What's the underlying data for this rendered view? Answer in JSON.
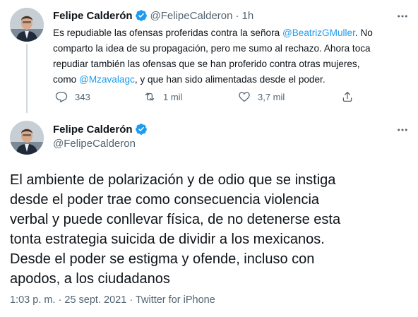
{
  "tweet1": {
    "name": "Felipe Calderón",
    "handle": "@FelipeCalderon",
    "separator": "·",
    "time": "1h",
    "body_lines": [
      [
        "Es repudiable las ofensas proferidas contra la señora ",
        "@BeatrizGMuller",
        ". No"
      ],
      [
        "comparto la idea de su propagación, pero me sumo al rechazo. Ahora toca"
      ],
      [
        "repudiar también las ofensas que se han proferido contra otras mujeres,"
      ],
      [
        "como ",
        "@Mzavalagc",
        ", y que han sido alimentadas desde el poder."
      ]
    ],
    "actions": {
      "reply_count": "343",
      "retweet_count": "1 mil",
      "like_count": "3,7 mil"
    }
  },
  "tweet2": {
    "name": "Felipe Calderón",
    "handle": "@FelipeCalderon",
    "body_lines": [
      "El ambiente de polarización y de odio que se instiga",
      "desde el poder trae como consecuencia violencia",
      "verbal y puede conllevar física, de no detenerse esta",
      "tonta estrategia suicida de dividir a los mexicanos.",
      "Desde el poder se estigma y ofende, incluso con",
      "apodos, a los ciudadanos"
    ],
    "time": "1:03 p. m.",
    "separator": "·",
    "date": "25 sept. 2021",
    "source": "Twitter for iPhone"
  },
  "colors": {
    "accent": "#1d9bf0",
    "secondary_text": "#536471",
    "primary_text": "#0f1419",
    "thread_line": "#cfd9de"
  },
  "icons": [
    "verified-badge-icon",
    "more-icon",
    "reply-icon",
    "retweet-icon",
    "like-icon",
    "share-icon"
  ]
}
